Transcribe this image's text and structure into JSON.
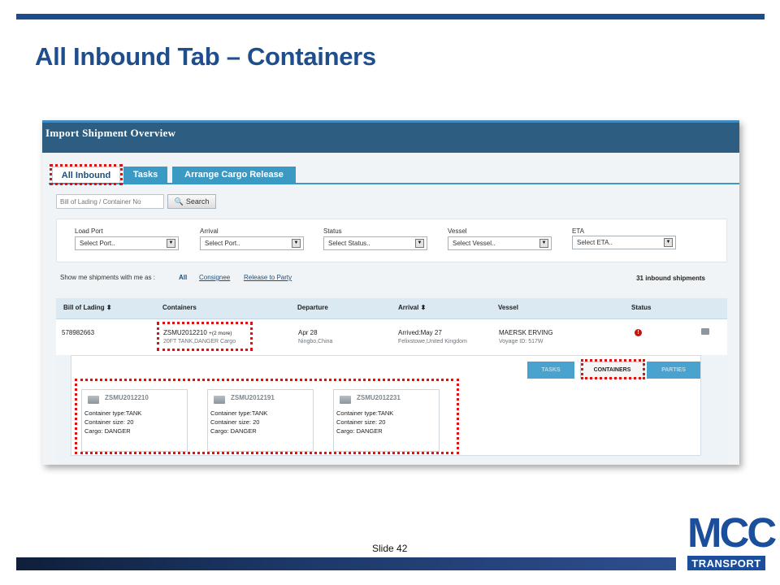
{
  "slide": {
    "title": "All Inbound Tab – Containers",
    "slide_number": "Slide 42"
  },
  "app": {
    "title": "Import Shipment Overview"
  },
  "tabs": [
    "All Inbound",
    "Tasks",
    "Arrange Cargo Release"
  ],
  "search": {
    "placeholder": "Bill of Lading / Container No",
    "button_label": "Search"
  },
  "filters": [
    {
      "label": "Load Port",
      "selected": "Select Port.."
    },
    {
      "label": "Arrival",
      "selected": "Select Port.."
    },
    {
      "label": "Status",
      "selected": "Select Status.."
    },
    {
      "label": "Vessel",
      "selected": "Select Vessel.."
    },
    {
      "label": "ETA",
      "selected": "Select ETA.."
    }
  ],
  "show_me": {
    "label": "Show me shipments with me as :",
    "options": [
      "All",
      "Consignee",
      "Release to Party"
    ],
    "selected": "All"
  },
  "shipment_count": "31 inbound shipments",
  "table": {
    "columns": [
      "Bill of Lading",
      "Containers",
      "Departure",
      "Arrival",
      "Vessel",
      "Status"
    ],
    "sort_icon": "⬍",
    "rows": [
      {
        "bill_of_lading": "578982663",
        "container": "ZSMU2012210",
        "container_more": "+(2 more)",
        "container_desc": "20FT TANK,DANGER Cargo",
        "departure_date": "Apr 28",
        "departure_place": "Ningbo,China",
        "arrival": "Arrived:May 27",
        "arrival_place": "Felixstowe,United Kingdom",
        "vessel": "MAERSK ERVING",
        "voyage": "Voyage ID: 517W",
        "status_icon": "!"
      }
    ]
  },
  "detail_tabs": [
    "TASKS",
    "CONTAINERS",
    "PARTIES"
  ],
  "containers": [
    {
      "id": "ZSMU2012210",
      "type": "Container type:TANK",
      "size": "Container size: 20",
      "cargo": "Cargo: DANGER"
    },
    {
      "id": "ZSMU2012191",
      "type": "Container type:TANK",
      "size": "Container size: 20",
      "cargo": "Cargo: DANGER"
    },
    {
      "id": "ZSMU2012231",
      "type": "Container type:TANK",
      "size": "Container size: 20",
      "cargo": "Cargo: DANGER"
    }
  ],
  "logo": {
    "top": "MCC",
    "bottom": "TRANSPORT"
  },
  "colors": {
    "brand_blue": "#1b4f9c",
    "header": "#2d5e82",
    "tab_blue": "#3a9ac4",
    "highlight": "#d01818"
  }
}
